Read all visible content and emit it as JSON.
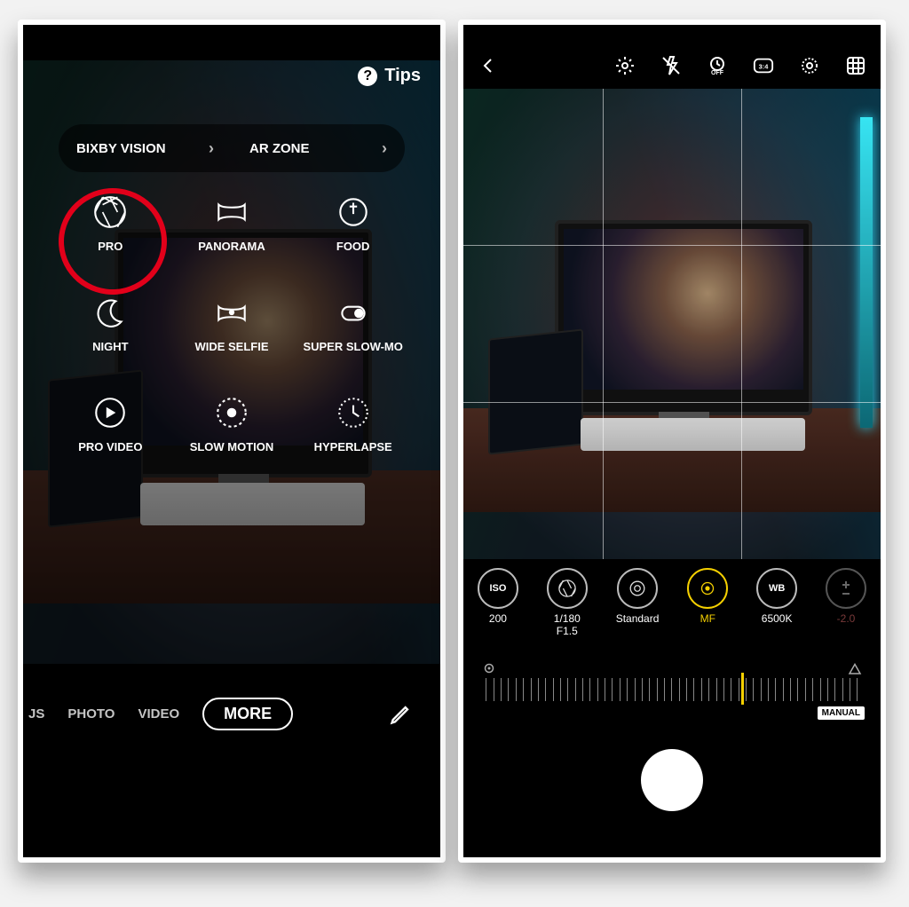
{
  "left": {
    "tips": "Tips",
    "pills": {
      "bixby": "BIXBY VISION",
      "arzone": "AR ZONE"
    },
    "modes": [
      {
        "id": "pro",
        "label": "PRO"
      },
      {
        "id": "panorama",
        "label": "PANORAMA"
      },
      {
        "id": "food",
        "label": "FOOD"
      },
      {
        "id": "night",
        "label": "NIGHT"
      },
      {
        "id": "wideselfie",
        "label": "WIDE SELFIE"
      },
      {
        "id": "superslowmo",
        "label": "SUPER SLOW-MO"
      },
      {
        "id": "provideo",
        "label": "PRO VIDEO"
      },
      {
        "id": "slowmotion",
        "label": "SLOW MOTION"
      },
      {
        "id": "hyperlapse",
        "label": "HYPERLAPSE"
      }
    ],
    "tabs": {
      "left": "JS",
      "photo": "PHOTO",
      "video": "VIDEO",
      "more": "MORE"
    }
  },
  "right": {
    "topbar": {
      "ratio": "3:4",
      "timerOff": "OFF"
    },
    "pro": {
      "iso": {
        "badge": "ISO",
        "value": "200"
      },
      "shutter": {
        "value": "1/180",
        "fstop": "F1.5"
      },
      "filter": {
        "value": "Standard"
      },
      "focus": {
        "badge": "",
        "value": "MF"
      },
      "wb": {
        "badge": "WB",
        "value": "6500K"
      },
      "ev": {
        "value": "-2.0"
      }
    },
    "slider": {
      "manual": "MANUAL"
    }
  }
}
